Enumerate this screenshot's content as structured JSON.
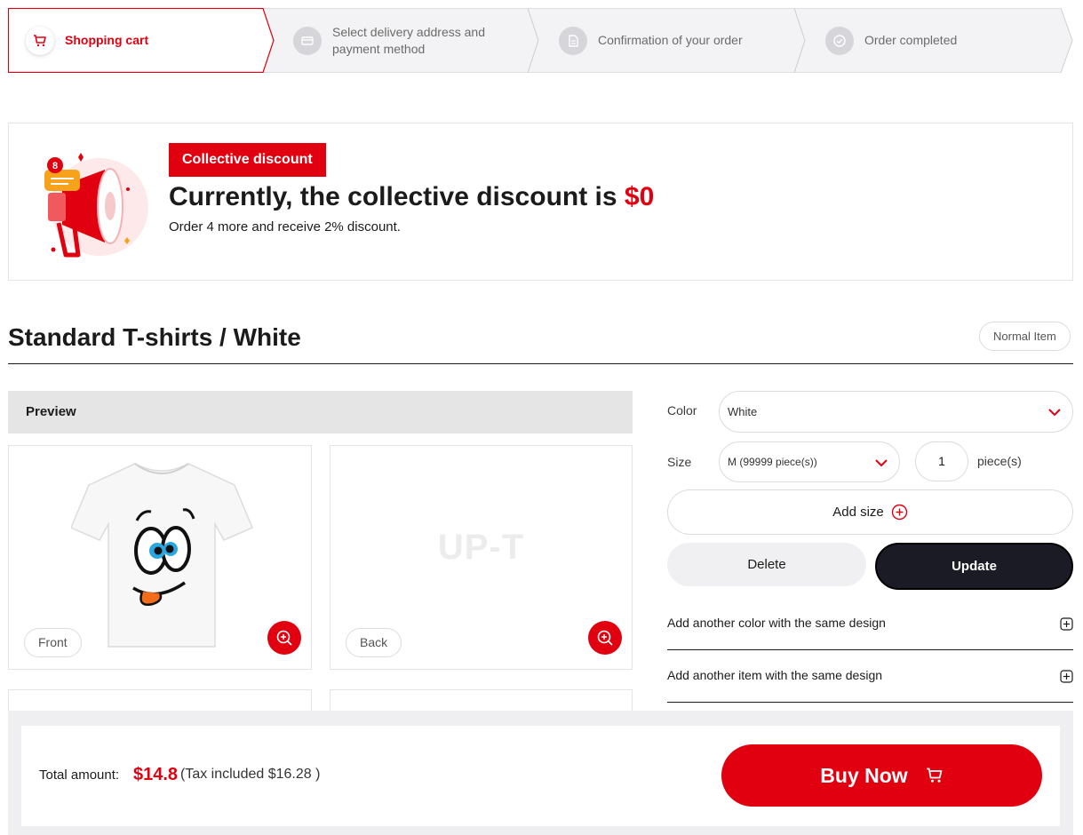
{
  "steps": [
    {
      "label": "Shopping cart",
      "icon": "cart-icon",
      "state": "active"
    },
    {
      "label": "Select delivery address and payment method",
      "icon": "card-icon",
      "state": "inactive"
    },
    {
      "label": "Confirmation of your order",
      "icon": "document-icon",
      "state": "inactive"
    },
    {
      "label": "Order completed",
      "icon": "check-icon",
      "state": "inactive"
    }
  ],
  "discount": {
    "tag": "Collective discount",
    "headline_prefix": "Currently, the collective discount is ",
    "headline_amount": "$0",
    "sub": "Order 4 more and receive 2% discount.",
    "icon": "megaphone-icon"
  },
  "product": {
    "title": "Standard T-shirts / White",
    "item_type": "Normal Item"
  },
  "preview": {
    "heading": "Preview",
    "front_label": "Front",
    "back_label": "Back",
    "back_placeholder": "UP-T"
  },
  "options": {
    "color_label": "Color",
    "color_value": "White",
    "size_label": "Size",
    "size_value": "M (99999 piece(s))",
    "quantity": "1",
    "quantity_unit": "piece(s)",
    "add_size": "Add size",
    "delete": "Delete",
    "update": "Update",
    "add_color": "Add another color with the same design",
    "add_item": "Add another item with the same design"
  },
  "summary": {
    "total_label": "Total amount:",
    "total_price": "$14.8",
    "tax_text": "(Tax included $16.28 )",
    "buy_now": "Buy Now"
  },
  "colors": {
    "accent": "#e0000f",
    "dark": "#1b1b26",
    "inactive_step": "#f3f3f5"
  }
}
